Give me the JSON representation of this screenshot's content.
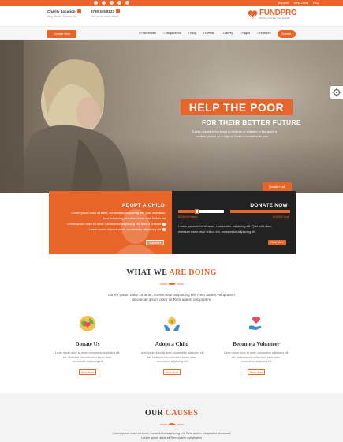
{
  "topbar": {
    "links": [
      "Support",
      "Help Desk",
      "FAQ"
    ]
  },
  "header": {
    "location_title": "Charity Location",
    "location_sub": "King Street, Sydney, US",
    "phone": "6780 345 8123",
    "phone_sub": "Call us for more details",
    "logo_text": "FUNDPRO",
    "logo_sub": "Helping For Charity NGO Template"
  },
  "nav": {
    "donate_top": "Donate Now",
    "items": [
      "Placeholder",
      "Mega Menu",
      "Blog",
      "Events",
      "Gallery",
      "Pages",
      "Features"
    ],
    "donate_pill": "Donate"
  },
  "hero": {
    "title": "HELP THE POOR",
    "subtitle": "FOR THEIR BETTER FUTURE",
    "text1": "Every day we bring hope to millions of children in the world's",
    "text2": "hardest places as a sign of God's unconditional love",
    "button": "Donate Now"
  },
  "adopt": {
    "title": "ADOPT A CHILD",
    "lines": [
      "Lorem ipsum dolor sit amet, consectetur adipiscing elit. Quis velit diam,",
      "dolor adipiscing interdum lorem vitae finibus est",
      "Lorem ipsum dolor sit amet, consectetur adipiscing elit. Mauris pretium",
      "Lorem ipsum dolor sit amet, consectetur adipiscing elit"
    ],
    "button": "Read More"
  },
  "donate": {
    "title": "DONATE NOW",
    "progress": 0.4,
    "raised": "$126k/9 Raised",
    "goal": "$15,500 Goal",
    "lines": [
      "Lorem ipsum dolor sit amet, consectetur adipiscing elit. Quis velit diam,",
      "interdum lorem vitae finibus est, consectetur adipiscing elit"
    ],
    "button": "Read More"
  },
  "doing": {
    "title_a": "WHAT WE ",
    "title_b": "ARE DOING",
    "text1": "Lorem ipsum dolor sit amet, consectetur adipiscing elit. Rem autem voluptatem",
    "text2": "obcaecati ipsum dolor sit Rem autem voluptatem",
    "features": [
      {
        "title": "Donate Us",
        "icon": "globe-heart-icon",
        "desc": [
          "Lorem ipsum dolor sit amet, consectetur adipiscing elit,",
          "elit. Molestias nisi nulla dolor ipsum dolor.",
          "consectetur adipiscing elit"
        ],
        "button": "Read More"
      },
      {
        "title": "Adopt a Child",
        "icon": "hands-coin-icon",
        "desc": [
          "Lorem ipsum dolor sit amet, consectetur adipiscing elit,",
          "elit. Molestias nisi nulla dolor ipsum dolor.",
          "consectetur adipiscing elit"
        ],
        "button": "Read More"
      },
      {
        "title": "Become a Volunteer",
        "icon": "hand-heart-icon",
        "desc": [
          "Lorem ipsum dolor sit amet, consectetur adipiscing elit,",
          "elit. Molestias nisi nulla dolor ipsum dolor.",
          "consectetur adipiscing elit"
        ],
        "button": "Read More"
      }
    ]
  },
  "causes": {
    "title_a": "OUR ",
    "title_b": "CAUSES",
    "text1": "Lorem ipsum dolor sit amet, consectetur adipiscing elit. Rem autem voluptatem obcaecati",
    "text2": "Lorem ipsum dolor sit Rem autem voluptatem"
  },
  "colors": {
    "accent": "#e8652a",
    "dark_box": "#222222"
  }
}
